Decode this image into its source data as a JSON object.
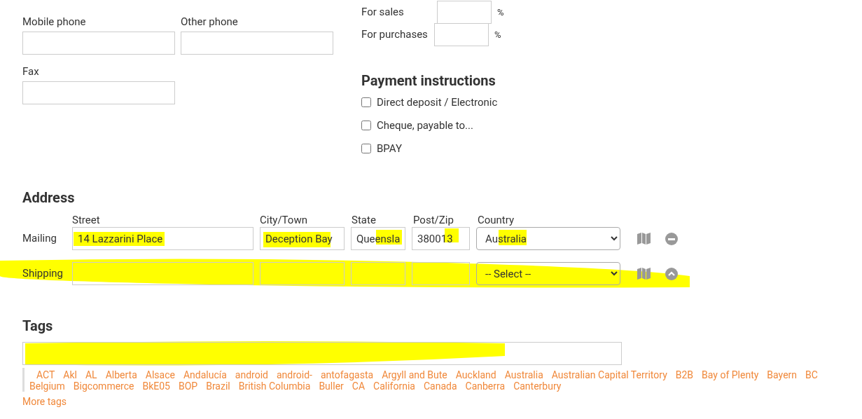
{
  "phone_fields": [
    {
      "label": "Mobile phone"
    },
    {
      "label": "Other phone"
    },
    {
      "label": "Fax"
    }
  ],
  "tax_rates": [
    {
      "label": "For sales",
      "unit": "%"
    },
    {
      "label": "For purchases",
      "unit": "%"
    }
  ],
  "payment_instructions": {
    "title": "Payment instructions",
    "options": [
      {
        "label": "Direct deposit / Electronic",
        "checked": false
      },
      {
        "label": "Cheque, payable to...",
        "checked": false
      },
      {
        "label": "BPAY",
        "checked": false
      }
    ]
  },
  "address": {
    "title": "Address",
    "columns": [
      "Street",
      "City/Town",
      "State",
      "Post/Zip",
      "Country"
    ],
    "rows": [
      {
        "label": "Mailing",
        "street": "14 Lazzarini Place",
        "city": "Deception Bay",
        "state": "Queensla",
        "zip": "380013",
        "country": "Australia"
      },
      {
        "label": "Shipping",
        "street": "",
        "city": "",
        "state": "",
        "zip": "",
        "country": "-- Select --"
      }
    ]
  },
  "tags": {
    "title": "Tags",
    "items": [
      "ACT",
      "Akl",
      "AL",
      "Alberta",
      "Alsace",
      "Andalucía",
      "android",
      "android-",
      "antofagasta",
      "Argyll and Bute",
      "Auckland",
      "Australia",
      "Australian Capital Territory",
      "B2B",
      "Bay of Plenty",
      "Bayern",
      "BC",
      "Belgium",
      "Bigcommerce",
      "BkE05",
      "BOP",
      "Brazil",
      "British Columbia",
      "Buller",
      "CA",
      "California",
      "Canada",
      "Canberra",
      "Canterbury"
    ],
    "more_link": "More tags"
  }
}
